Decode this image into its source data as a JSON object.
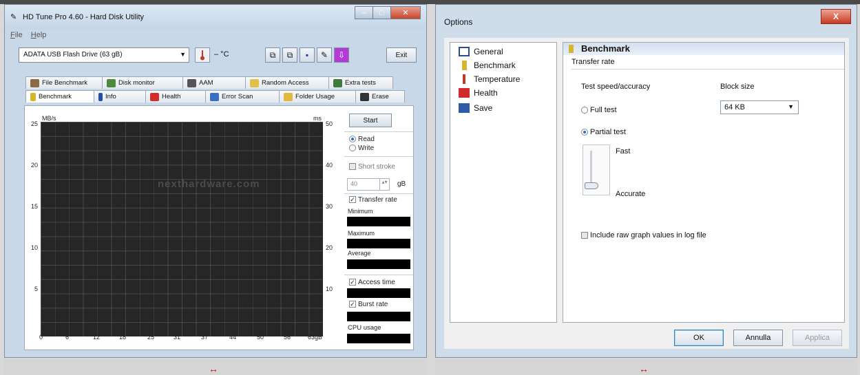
{
  "hdtune": {
    "title": "HD Tune Pro 4.60 - Hard Disk Utility",
    "menu": [
      "File",
      "Help"
    ],
    "drive": "ADATA  USB Flash Drive  (63 gB)",
    "temperature": "– °C",
    "exit_label": "Exit",
    "tabs_row1": [
      "File Benchmark",
      "Disk monitor",
      "AAM",
      "Random Access",
      "Extra tests"
    ],
    "tabs_row2": [
      "Benchmark",
      "Info",
      "Health",
      "Error Scan",
      "Folder Usage",
      "Erase"
    ],
    "graph": {
      "left_unit": "MB/s",
      "right_unit": "ms",
      "watermark": "nexthardware.com",
      "y_left": [
        "25",
        "20",
        "15",
        "10",
        "5"
      ],
      "y_right": [
        "50",
        "40",
        "30",
        "20",
        "10"
      ],
      "x": [
        "0",
        "6",
        "12",
        "18",
        "25",
        "31",
        "37",
        "44",
        "50",
        "56",
        "63gB"
      ]
    },
    "side": {
      "start": "Start",
      "read": "Read",
      "write": "Write",
      "short_stroke": "Short stroke",
      "stroke_value": "40",
      "stroke_unit": "gB",
      "transfer_rate": "Transfer rate",
      "minimum": "Minimum",
      "maximum": "Maximum",
      "average": "Average",
      "access_time": "Access time",
      "burst_rate": "Burst rate",
      "cpu_usage": "CPU usage"
    }
  },
  "options": {
    "title": "Options",
    "close": "X",
    "tree": [
      "General",
      "Benchmark",
      "Temperature",
      "Health",
      "Save"
    ],
    "pane_title": "Benchmark",
    "section": "Transfer rate",
    "speed_label": "Test speed/accuracy",
    "block_label": "Block size",
    "block_value": "64 KB",
    "full_test": "Full test",
    "partial_test": "Partial test",
    "fast": "Fast",
    "accurate": "Accurate",
    "raw_values": "Include raw graph values in log file",
    "ok": "OK",
    "cancel": "Annulla",
    "apply": "Applica"
  },
  "footer_arrow": "↔"
}
